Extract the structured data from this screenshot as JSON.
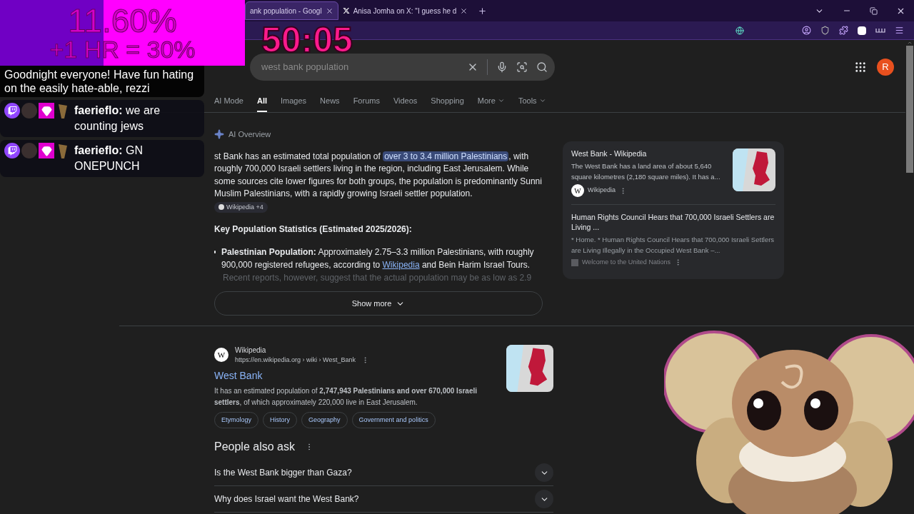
{
  "browser": {
    "tabs": [
      {
        "title": "ank population - Googl",
        "kind": "page",
        "selected": true
      },
      {
        "title": "Anisa Jomha on X: \"I guess he d",
        "kind": "x",
        "selected": false
      }
    ]
  },
  "stream_overlay": {
    "goal": {
      "line_1": "11.60%",
      "line_2": "+1 HR = 30%"
    },
    "timer": "50:05",
    "chat": [
      {
        "kind": "notice",
        "text": "Goodnight everyone! Have fun hating on the easily hate-able, rezzi"
      },
      {
        "kind": "message",
        "user": "faerieflo:",
        "text": "we are counting jews"
      },
      {
        "kind": "message",
        "user": "faerieflo:",
        "text": "GN ONEPUNCH"
      }
    ]
  },
  "search": {
    "query": "west bank population",
    "avatar": "R",
    "tabs": [
      {
        "label": "AI Mode",
        "selected": false,
        "menu": false
      },
      {
        "label": "All",
        "selected": true,
        "menu": false
      },
      {
        "label": "Images",
        "selected": false,
        "menu": false
      },
      {
        "label": "News",
        "selected": false,
        "menu": false
      },
      {
        "label": "Forums",
        "selected": false,
        "menu": false
      },
      {
        "label": "Videos",
        "selected": false,
        "menu": false
      },
      {
        "label": "Shopping",
        "selected": false,
        "menu": false
      },
      {
        "label": "More",
        "selected": false,
        "menu": true
      },
      {
        "label": "Tools",
        "selected": false,
        "menu": true
      }
    ]
  },
  "ai_overview": {
    "label": "AI Overview",
    "lead": "st Bank has an estimated total population of ",
    "highlight": "over 3 to 3.4 million Palestinians",
    "rest": ", with roughly 700,000 Israeli settlers living in the region, including East Jerusalem. While some sources cite lower figures for both groups, the population is predominantly Sunni Muslim Palestinians, with a rapidly growing Israeli settler population.",
    "citation": "Wikipedia +4",
    "heading": "Key Population Statistics (Estimated 2025/2026):",
    "bullet": {
      "text": "**Palestinian Population:** Approximately 2.75–3.3 million Palestinians, with roughly 900,000 registered refugees, according to ",
      "link": "Wikipedia",
      "after": " and Bein Harim Israel Tours."
    },
    "faded": "Recent reports, however, suggest that the actual population may be as low as 2.9",
    "show_more": "Show more",
    "sources": [
      {
        "kind": "with_image",
        "title": "West Bank - Wikipedia",
        "snippet": "The West Bank has a land area of about 5,640 square kilometres (2,180 square miles). It has a...",
        "site": "Wikipedia",
        "logo": "W"
      },
      {
        "kind": "text_only",
        "title": "Human Rights Council Hears that 700,000 Israeli Settlers are Living ...",
        "snippet": "* Home. * Human Rights Council Hears that 700,000 Israeli Settlers are Living Illegally in the Occupied West Bank –...",
        "site": "Welcome to the United Nations"
      }
    ]
  },
  "result": {
    "site": "Wikipedia",
    "logo": "W",
    "url": "https://en.wikipedia.org › wiki › West_Bank",
    "title": "West Bank",
    "snippet": "It has an estimated population of **2,747,943 Palestinians and over 670,000 Israeli settlers**, of which approximately 220,000 live in East Jerusalem.",
    "chips": [
      "Etymology",
      "History",
      "Geography",
      "Government and politics"
    ]
  },
  "people_also_ask": {
    "title": "People also ask",
    "questions": [
      "Is the West Bank bigger than Gaza?",
      "Why does Israel want the West Bank?"
    ]
  }
}
